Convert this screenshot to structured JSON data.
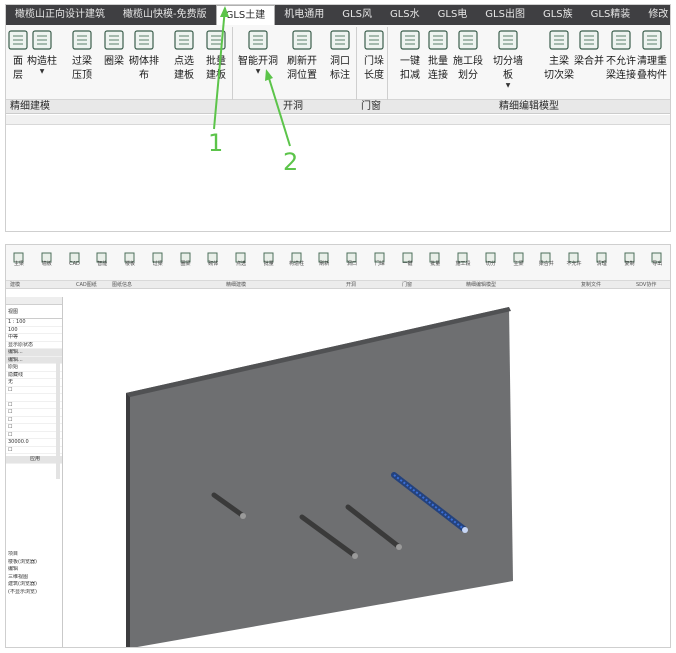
{
  "top": {
    "tabs": [
      "橄榄山正向设计建筑",
      "橄榄山快模-免费版",
      "GLS土建",
      "机电通用",
      "GLS风",
      "GLS水",
      "GLS电",
      "GLS出图",
      "GLS族",
      "GLS精装",
      "修改"
    ],
    "active_tab_index": 2,
    "ribbon_buttons": [
      {
        "label1": "面",
        "label2": "层",
        "icon": "floor-icon",
        "drop": false
      },
      {
        "label1": "构造柱",
        "label2": "",
        "icon": "construction-column-icon",
        "drop": true
      },
      {
        "label1": "过梁",
        "label2": "压顶",
        "icon": "lintel-icon",
        "drop": false
      },
      {
        "label1": "圈梁",
        "label2": "",
        "icon": "ring-beam-icon",
        "drop": false
      },
      {
        "label1": "砌体排布",
        "label2": "",
        "icon": "masonry-layout-icon",
        "drop": false
      },
      {
        "label1": "点选",
        "label2": "建板",
        "icon": "pick-slab-icon",
        "drop": false
      },
      {
        "label1": "批量",
        "label2": "建板",
        "icon": "batch-slab-icon",
        "drop": false
      },
      {
        "label1": "智能开洞",
        "label2": "",
        "icon": "smart-opening-icon",
        "drop": true
      },
      {
        "label1": "刷新开",
        "label2": "洞位置",
        "icon": "refresh-opening-icon",
        "drop": false
      },
      {
        "label1": "洞口",
        "label2": "标注",
        "icon": "opening-tag-icon",
        "drop": false
      },
      {
        "label1": "门垛",
        "label2": "长度",
        "icon": "door-jamb-icon",
        "drop": false
      },
      {
        "label1": "一键",
        "label2": "扣减",
        "icon": "one-click-deduct-icon",
        "drop": false
      },
      {
        "label1": "批量",
        "label2": "连接",
        "icon": "batch-join-icon",
        "drop": false
      },
      {
        "label1": "施工段",
        "label2": "划分",
        "icon": "construction-section-icon",
        "drop": false
      },
      {
        "label1": "切分墙板",
        "label2": "",
        "icon": "split-wall-icon",
        "drop": true
      },
      {
        "label1": "主梁",
        "label2": "切次梁",
        "icon": "main-beam-icon",
        "drop": false
      },
      {
        "label1": "梁合并",
        "label2": "",
        "icon": "beam-merge-icon",
        "drop": false
      },
      {
        "label1": "不允许",
        "label2": "梁连接",
        "icon": "disallow-join-icon",
        "drop": false
      },
      {
        "label1": "清理重",
        "label2": "叠构件",
        "icon": "clean-overlap-icon",
        "drop": false
      }
    ],
    "group_labels": [
      "精细建模",
      "开洞",
      "门窗",
      "精细编辑模型"
    ],
    "annotations": [
      "1",
      "2"
    ]
  },
  "bottom": {
    "mini_ribbon_labels": [
      "主梁",
      "墙板",
      "CAD",
      "智能",
      "楼板",
      "过梁",
      "圈梁",
      "砌体",
      "点选",
      "批量",
      "构造柱",
      "刷新",
      "洞口",
      "门垛",
      "一键",
      "批量",
      "施工段",
      "切分",
      "主梁",
      "梁合并",
      "不允许",
      "清理",
      "复制",
      "导出"
    ],
    "mini_group_labels": [
      "建模",
      "CAD图纸",
      "图纸信息",
      "精细建模",
      "开洞",
      "门窗",
      "精细编辑模型",
      "复制文件",
      "SDV协作"
    ],
    "props": {
      "header": "属性",
      "type_value": "视图",
      "rows": [
        "1 : 100",
        "100",
        "中等",
        "显示原状态",
        "编辑...",
        "编辑...",
        "原始",
        "隐藏线",
        "无",
        "☐",
        "",
        "☐",
        "☐",
        "☐",
        "☐",
        "☐",
        "30000.0",
        "☐"
      ],
      "apply_label": "应用",
      "footer": [
        "项目",
        "楼板(浏览器)",
        "编辑",
        "三维视图",
        "建筑(浏览器)",
        "(不显示浏览)"
      ]
    },
    "colors": {
      "wall": "#6e6f71",
      "wall_dark": "#3c3c3e",
      "pipe": "#4a4a4a",
      "selected": "#3a6fd8"
    }
  }
}
